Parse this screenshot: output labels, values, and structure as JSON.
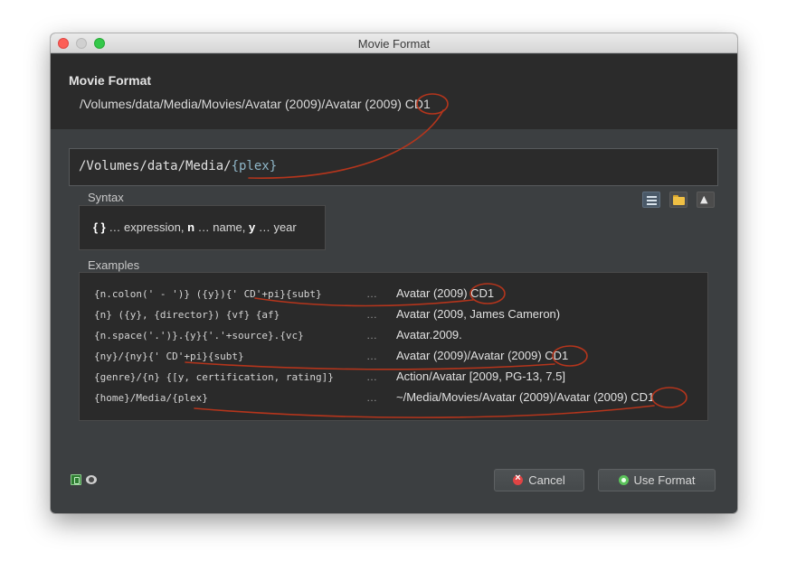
{
  "window": {
    "title": "Movie Format"
  },
  "header": {
    "title": "Movie Format",
    "sample_path": "/Volumes/data/Media/Movies/Avatar (2009)/Avatar (2009) CD1"
  },
  "format_input": {
    "prefix": "/Volumes/data/Media/",
    "expression": "{plex}"
  },
  "syntax": {
    "label": "Syntax",
    "braces": "{ }",
    "text1": " … expression, ",
    "n": "n",
    "text2": " … name, ",
    "y": "y",
    "text3": " … year"
  },
  "toolbar": {
    "list_icon": "list-icon",
    "folder_icon": "folder-icon",
    "plex_icon": "plex-icon"
  },
  "examples": {
    "label": "Examples",
    "dots": "…",
    "rows": [
      {
        "code": "{n.colon(' - ')} ({y}){' CD'+pi}{subt}",
        "result": "Avatar (2009) CD1"
      },
      {
        "code": "{n} ({y}, {director}) {vf} {af}",
        "result": "Avatar (2009, James Cameron)"
      },
      {
        "code": "{n.space('.')}.{y}{'.'+source}.{vc}",
        "result": "Avatar.2009."
      },
      {
        "code": "{ny}/{ny}{' CD'+pi}{subt}",
        "result": "Avatar (2009)/Avatar (2009) CD1"
      },
      {
        "code": "{genre}/{n} {[y, certification, rating]}",
        "result": "Action/Avatar [2009, PG-13, 7.5]"
      },
      {
        "code": "{home}/Media/{plex}",
        "result": "~/Media/Movies/Avatar (2009)/Avatar (2009) CD1"
      }
    ]
  },
  "buttons": {
    "cancel": "Cancel",
    "use_format": "Use Format"
  },
  "colors": {
    "annotation": "#b5351c",
    "window_bg": "#3c3f41",
    "header_bg": "#2b2b2b"
  }
}
